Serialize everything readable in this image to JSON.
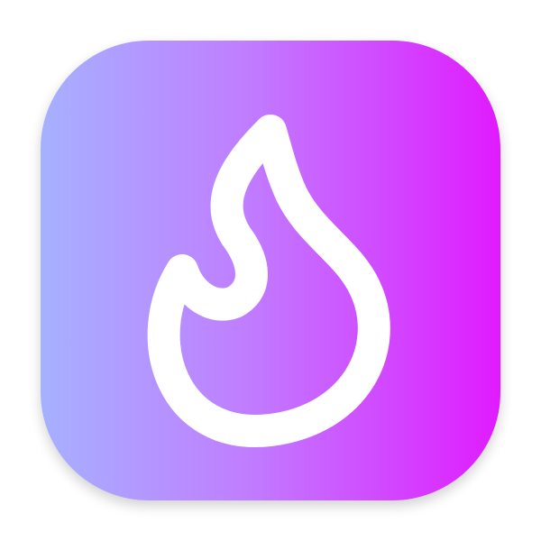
{
  "icon": {
    "name": "flame-icon",
    "colors": {
      "gradient_start": "#a6b1ff",
      "gradient_mid": "#c07dff",
      "gradient_end": "#e01bff",
      "glyph": "#ffffff"
    }
  }
}
